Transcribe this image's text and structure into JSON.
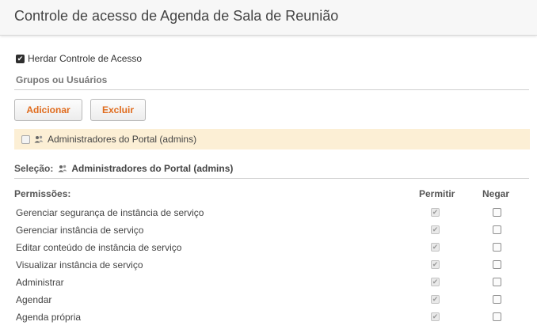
{
  "header": {
    "title": "Controle de acesso de Agenda de Sala de Reunião"
  },
  "inherit": {
    "label": "Herdar Controle de Acesso",
    "checked": true
  },
  "groups_section": {
    "label": "Grupos ou Usuários"
  },
  "buttons": {
    "add_label": "Adicionar",
    "delete_label": "Excluir"
  },
  "group_list": [
    {
      "name": "Administradores do Portal (admins)",
      "checked": false
    }
  ],
  "selection": {
    "label": "Seleção:",
    "value": "Administradores do Portal (admins)"
  },
  "permissions": {
    "header_label": "Permissões:",
    "allow_label": "Permitir",
    "deny_label": "Negar",
    "rows": [
      {
        "name": "Gerenciar segurança de instância de serviço",
        "allow": true,
        "deny": false
      },
      {
        "name": "Gerenciar instância de serviço",
        "allow": true,
        "deny": false
      },
      {
        "name": "Editar conteúdo de instância de serviço",
        "allow": true,
        "deny": false
      },
      {
        "name": "Visualizar instância de serviço",
        "allow": true,
        "deny": false
      },
      {
        "name": "Administrar",
        "allow": true,
        "deny": false
      },
      {
        "name": "Agendar",
        "allow": true,
        "deny": false
      },
      {
        "name": "Agenda própria",
        "allow": true,
        "deny": false
      }
    ]
  },
  "colors": {
    "accent": "#e06c1e",
    "highlight_row": "#fcefd5"
  },
  "icons": {
    "group_icon": "users-icon"
  }
}
